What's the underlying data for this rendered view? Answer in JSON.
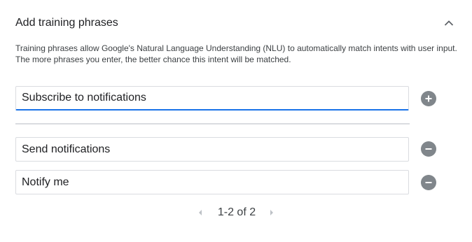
{
  "section": {
    "title": "Add training phrases",
    "collapse_icon": "chevron-up-icon",
    "description_lines": [
      "Training phrases allow Google's Natural Language Understanding (NLU) to automatically match intents with user input.",
      "The more phrases you enter, the better chance this intent will be matched."
    ]
  },
  "new_phrase": {
    "value": "Subscribe to notifications",
    "add_icon": "add-circle-icon"
  },
  "phrases": [
    {
      "value": "Send notifications",
      "remove_icon": "remove-circle-icon"
    },
    {
      "value": "Notify me",
      "remove_icon": "remove-circle-icon"
    }
  ],
  "pagination": {
    "label": "1-2 of 2",
    "prev_icon": "chevron-left-icon",
    "next_icon": "chevron-right-icon"
  },
  "colors": {
    "accent": "#1a73e8",
    "icon_gray": "#80868b",
    "border": "#dadce0",
    "text": "#202124"
  }
}
